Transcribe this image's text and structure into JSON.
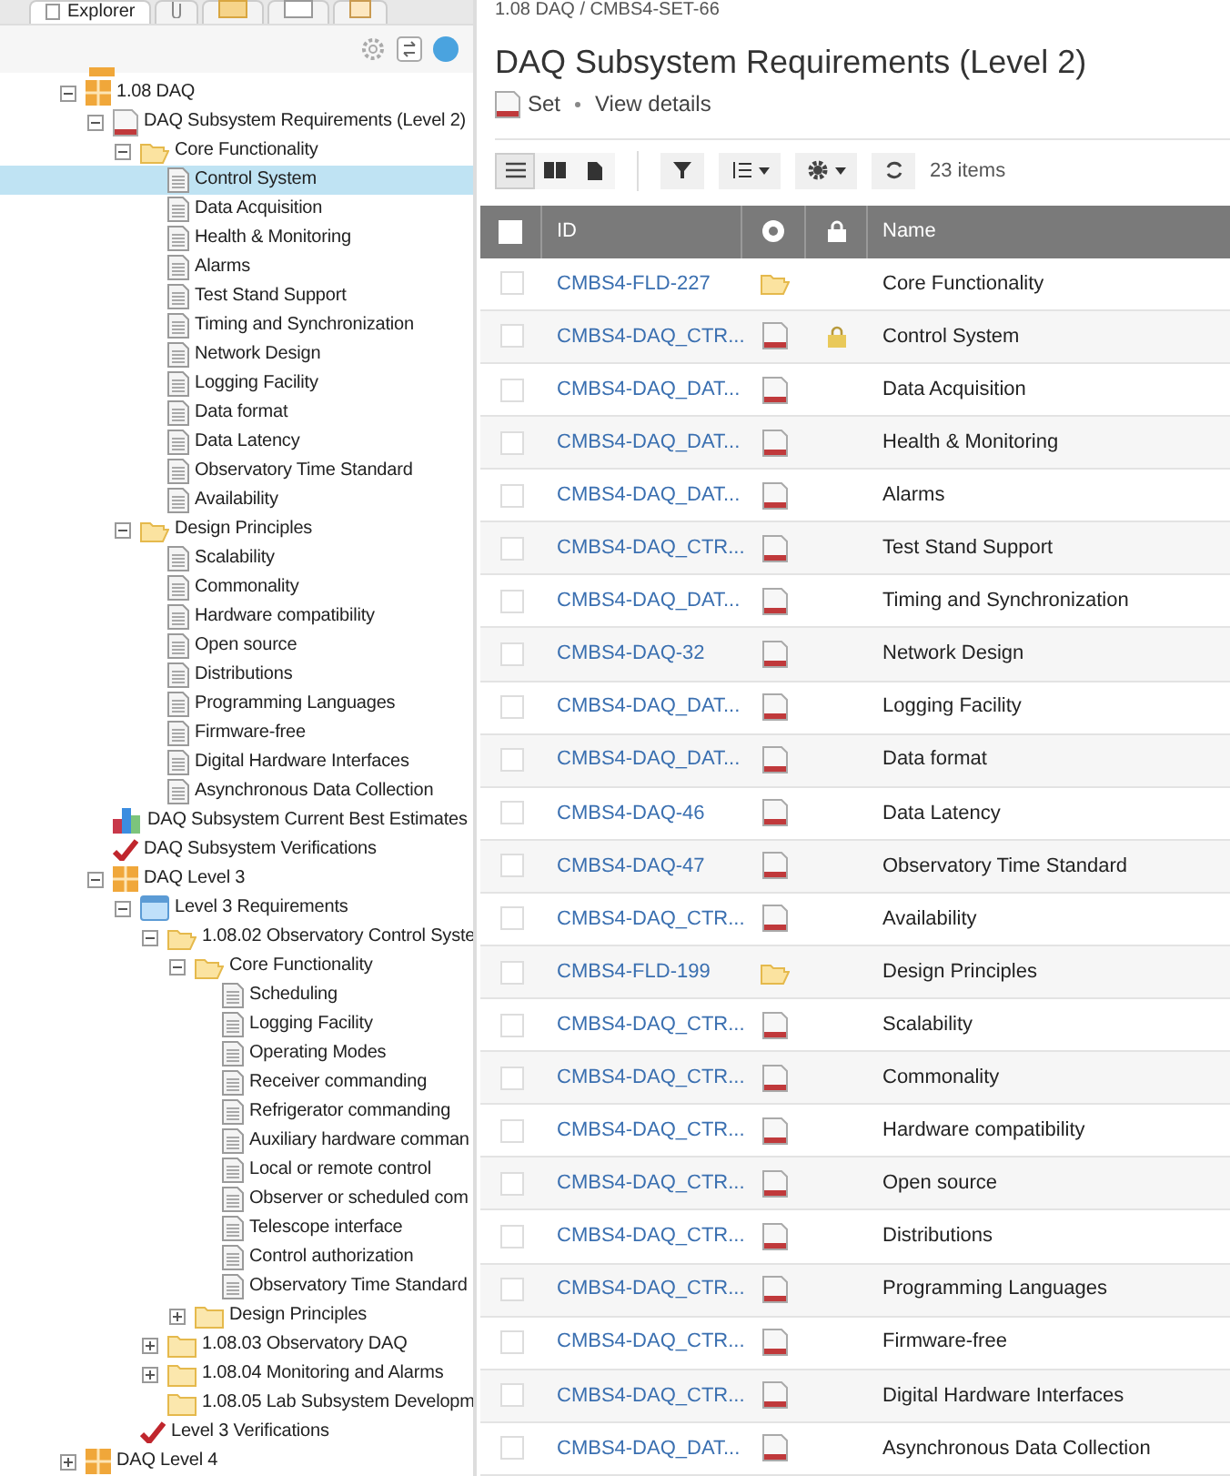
{
  "explorer": {
    "tabs": [
      {
        "kind": "text",
        "label": "Explorer",
        "selected": true
      },
      {
        "kind": "clip",
        "selected": false
      },
      {
        "kind": "grid",
        "selected": false
      },
      {
        "kind": "blank",
        "selected": false
      },
      {
        "kind": "doc",
        "selected": false
      }
    ],
    "tree": [
      {
        "kind": "grid",
        "label": "1.08 DAQ",
        "expanded": true,
        "selected": false,
        "children": [
          {
            "kind": "set",
            "label": "DAQ Subsystem Requirements (Level 2)",
            "expanded": true,
            "selected": false,
            "children": [
              {
                "kind": "folder",
                "label": "Core Functionality",
                "expanded": true,
                "selected": false,
                "children": [
                  {
                    "kind": "doc",
                    "label": "Control System",
                    "selected": true
                  },
                  {
                    "kind": "doc",
                    "label": "Data Acquisition",
                    "selected": false
                  },
                  {
                    "kind": "doc",
                    "label": "Health & Monitoring",
                    "selected": false
                  },
                  {
                    "kind": "doc",
                    "label": "Alarms",
                    "selected": false
                  },
                  {
                    "kind": "doc",
                    "label": "Test Stand Support",
                    "selected": false
                  },
                  {
                    "kind": "doc",
                    "label": "Timing and Synchronization",
                    "selected": false
                  },
                  {
                    "kind": "doc",
                    "label": "Network Design",
                    "selected": false
                  },
                  {
                    "kind": "doc",
                    "label": "Logging Facility",
                    "selected": false
                  },
                  {
                    "kind": "doc",
                    "label": "Data format",
                    "selected": false
                  },
                  {
                    "kind": "doc",
                    "label": "Data Latency",
                    "selected": false
                  },
                  {
                    "kind": "doc",
                    "label": "Observatory Time Standard",
                    "selected": false
                  },
                  {
                    "kind": "doc",
                    "label": "Availability",
                    "selected": false
                  }
                ]
              },
              {
                "kind": "folder",
                "label": "Design Principles",
                "expanded": true,
                "selected": false,
                "children": [
                  {
                    "kind": "doc",
                    "label": "Scalability",
                    "selected": false
                  },
                  {
                    "kind": "doc",
                    "label": "Commonality",
                    "selected": false
                  },
                  {
                    "kind": "doc",
                    "label": "Hardware compatibility",
                    "selected": false
                  },
                  {
                    "kind": "doc",
                    "label": "Open source",
                    "selected": false
                  },
                  {
                    "kind": "doc",
                    "label": "Distributions",
                    "selected": false
                  },
                  {
                    "kind": "doc",
                    "label": "Programming Languages",
                    "selected": false
                  },
                  {
                    "kind": "doc",
                    "label": "Firmware-free",
                    "selected": false
                  },
                  {
                    "kind": "doc",
                    "label": "Digital Hardware Interfaces",
                    "selected": false
                  },
                  {
                    "kind": "doc",
                    "label": "Asynchronous Data Collection",
                    "selected": false
                  }
                ]
              }
            ]
          },
          {
            "kind": "chart",
            "label": "DAQ Subsystem Current Best Estimates",
            "selected": false
          },
          {
            "kind": "check",
            "label": "DAQ Subsystem Verifications",
            "selected": false
          },
          {
            "kind": "grid",
            "label": "DAQ Level 3",
            "expanded": true,
            "selected": false,
            "children": [
              {
                "kind": "window",
                "label": "Level 3 Requirements",
                "expanded": true,
                "selected": false,
                "children": [
                  {
                    "kind": "folder",
                    "label": "1.08.02 Observatory Control Syste",
                    "expanded": true,
                    "selected": false,
                    "children": [
                      {
                        "kind": "folder",
                        "label": "Core Functionality",
                        "expanded": true,
                        "selected": false,
                        "children": [
                          {
                            "kind": "doc",
                            "label": "Scheduling",
                            "selected": false
                          },
                          {
                            "kind": "doc",
                            "label": "Logging Facility",
                            "selected": false
                          },
                          {
                            "kind": "doc",
                            "label": "Operating Modes",
                            "selected": false
                          },
                          {
                            "kind": "doc",
                            "label": "Receiver commanding",
                            "selected": false
                          },
                          {
                            "kind": "doc",
                            "label": "Refrigerator commanding",
                            "selected": false
                          },
                          {
                            "kind": "doc",
                            "label": "Auxiliary hardware comman",
                            "selected": false
                          },
                          {
                            "kind": "doc",
                            "label": "Local or remote control",
                            "selected": false
                          },
                          {
                            "kind": "doc",
                            "label": "Observer or scheduled com",
                            "selected": false
                          },
                          {
                            "kind": "doc",
                            "label": "Telescope interface",
                            "selected": false
                          },
                          {
                            "kind": "doc",
                            "label": "Control authorization",
                            "selected": false
                          },
                          {
                            "kind": "doc",
                            "label": "Observatory Time Standard",
                            "selected": false
                          }
                        ]
                      },
                      {
                        "kind": "folder",
                        "label": "Design Principles",
                        "expanded": false,
                        "selected": false
                      }
                    ]
                  },
                  {
                    "kind": "folder",
                    "label": "1.08.03 Observatory DAQ",
                    "expanded": false,
                    "selected": false
                  },
                  {
                    "kind": "folder",
                    "label": "1.08.04 Monitoring and Alarms",
                    "expanded": false,
                    "selected": false
                  },
                  {
                    "kind": "folder",
                    "label": "1.08.05 Lab Subsystem Developm",
                    "selected": false
                  }
                ]
              },
              {
                "kind": "check",
                "label": "Level 3 Verifications",
                "selected": false
              }
            ]
          }
        ]
      },
      {
        "kind": "grid",
        "label": "DAQ Level 4",
        "expanded": false,
        "selected": false
      }
    ]
  },
  "main": {
    "breadcrumb": "1.08 DAQ / CMBS4-SET-66",
    "title": "DAQ Subsystem Requirements (Level 2)",
    "type": "Set",
    "details_link": "View details",
    "views": [
      {
        "kind": "list",
        "selected": true
      },
      {
        "kind": "book",
        "selected": false
      },
      {
        "kind": "page",
        "selected": false
      }
    ],
    "count": "23 items",
    "table": {
      "columns": [
        "ID",
        "Name"
      ],
      "header_checked": false,
      "rows": [
        {
          "id": "CMBS4-FLD-227",
          "kind": "folder",
          "locked": false,
          "name": "Core Functionality",
          "checked": false
        },
        {
          "id": "CMBS4-DAQ_CTR...",
          "kind": "doc",
          "locked": true,
          "name": "Control System",
          "checked": false
        },
        {
          "id": "CMBS4-DAQ_DAT...",
          "kind": "doc",
          "locked": false,
          "name": "Data Acquisition",
          "checked": false
        },
        {
          "id": "CMBS4-DAQ_DAT...",
          "kind": "doc",
          "locked": false,
          "name": "Health & Monitoring",
          "checked": false
        },
        {
          "id": "CMBS4-DAQ_DAT...",
          "kind": "doc",
          "locked": false,
          "name": "Alarms",
          "checked": false
        },
        {
          "id": "CMBS4-DAQ_CTR...",
          "kind": "doc",
          "locked": false,
          "name": "Test Stand Support",
          "checked": false
        },
        {
          "id": "CMBS4-DAQ_DAT...",
          "kind": "doc",
          "locked": false,
          "name": "Timing and Synchronization",
          "checked": false
        },
        {
          "id": "CMBS4-DAQ-32",
          "kind": "doc",
          "locked": false,
          "name": "Network Design",
          "checked": false
        },
        {
          "id": "CMBS4-DAQ_DAT...",
          "kind": "doc",
          "locked": false,
          "name": "Logging Facility",
          "checked": false
        },
        {
          "id": "CMBS4-DAQ_DAT...",
          "kind": "doc",
          "locked": false,
          "name": "Data format",
          "checked": false
        },
        {
          "id": "CMBS4-DAQ-46",
          "kind": "doc",
          "locked": false,
          "name": "Data Latency",
          "checked": false
        },
        {
          "id": "CMBS4-DAQ-47",
          "kind": "doc",
          "locked": false,
          "name": "Observatory Time Standard",
          "checked": false
        },
        {
          "id": "CMBS4-DAQ_CTR...",
          "kind": "doc",
          "locked": false,
          "name": "Availability",
          "checked": false
        },
        {
          "id": "CMBS4-FLD-199",
          "kind": "folder",
          "locked": false,
          "name": "Design Principles",
          "checked": false
        },
        {
          "id": "CMBS4-DAQ_CTR...",
          "kind": "doc",
          "locked": false,
          "name": "Scalability",
          "checked": false
        },
        {
          "id": "CMBS4-DAQ_CTR...",
          "kind": "doc",
          "locked": false,
          "name": "Commonality",
          "checked": false
        },
        {
          "id": "CMBS4-DAQ_CTR...",
          "kind": "doc",
          "locked": false,
          "name": "Hardware compatibility",
          "checked": false
        },
        {
          "id": "CMBS4-DAQ_CTR...",
          "kind": "doc",
          "locked": false,
          "name": "Open source",
          "checked": false
        },
        {
          "id": "CMBS4-DAQ_CTR...",
          "kind": "doc",
          "locked": false,
          "name": "Distributions",
          "checked": false
        },
        {
          "id": "CMBS4-DAQ_CTR...",
          "kind": "doc",
          "locked": false,
          "name": "Programming Languages",
          "checked": false
        },
        {
          "id": "CMBS4-DAQ_CTR...",
          "kind": "doc",
          "locked": false,
          "name": "Firmware-free",
          "checked": false
        },
        {
          "id": "CMBS4-DAQ_CTR...",
          "kind": "doc",
          "locked": false,
          "name": "Digital Hardware Interfaces",
          "checked": false
        },
        {
          "id": "CMBS4-DAQ_DAT...",
          "kind": "doc",
          "locked": false,
          "name": "Asynchronous Data Collection",
          "checked": false
        }
      ]
    }
  }
}
